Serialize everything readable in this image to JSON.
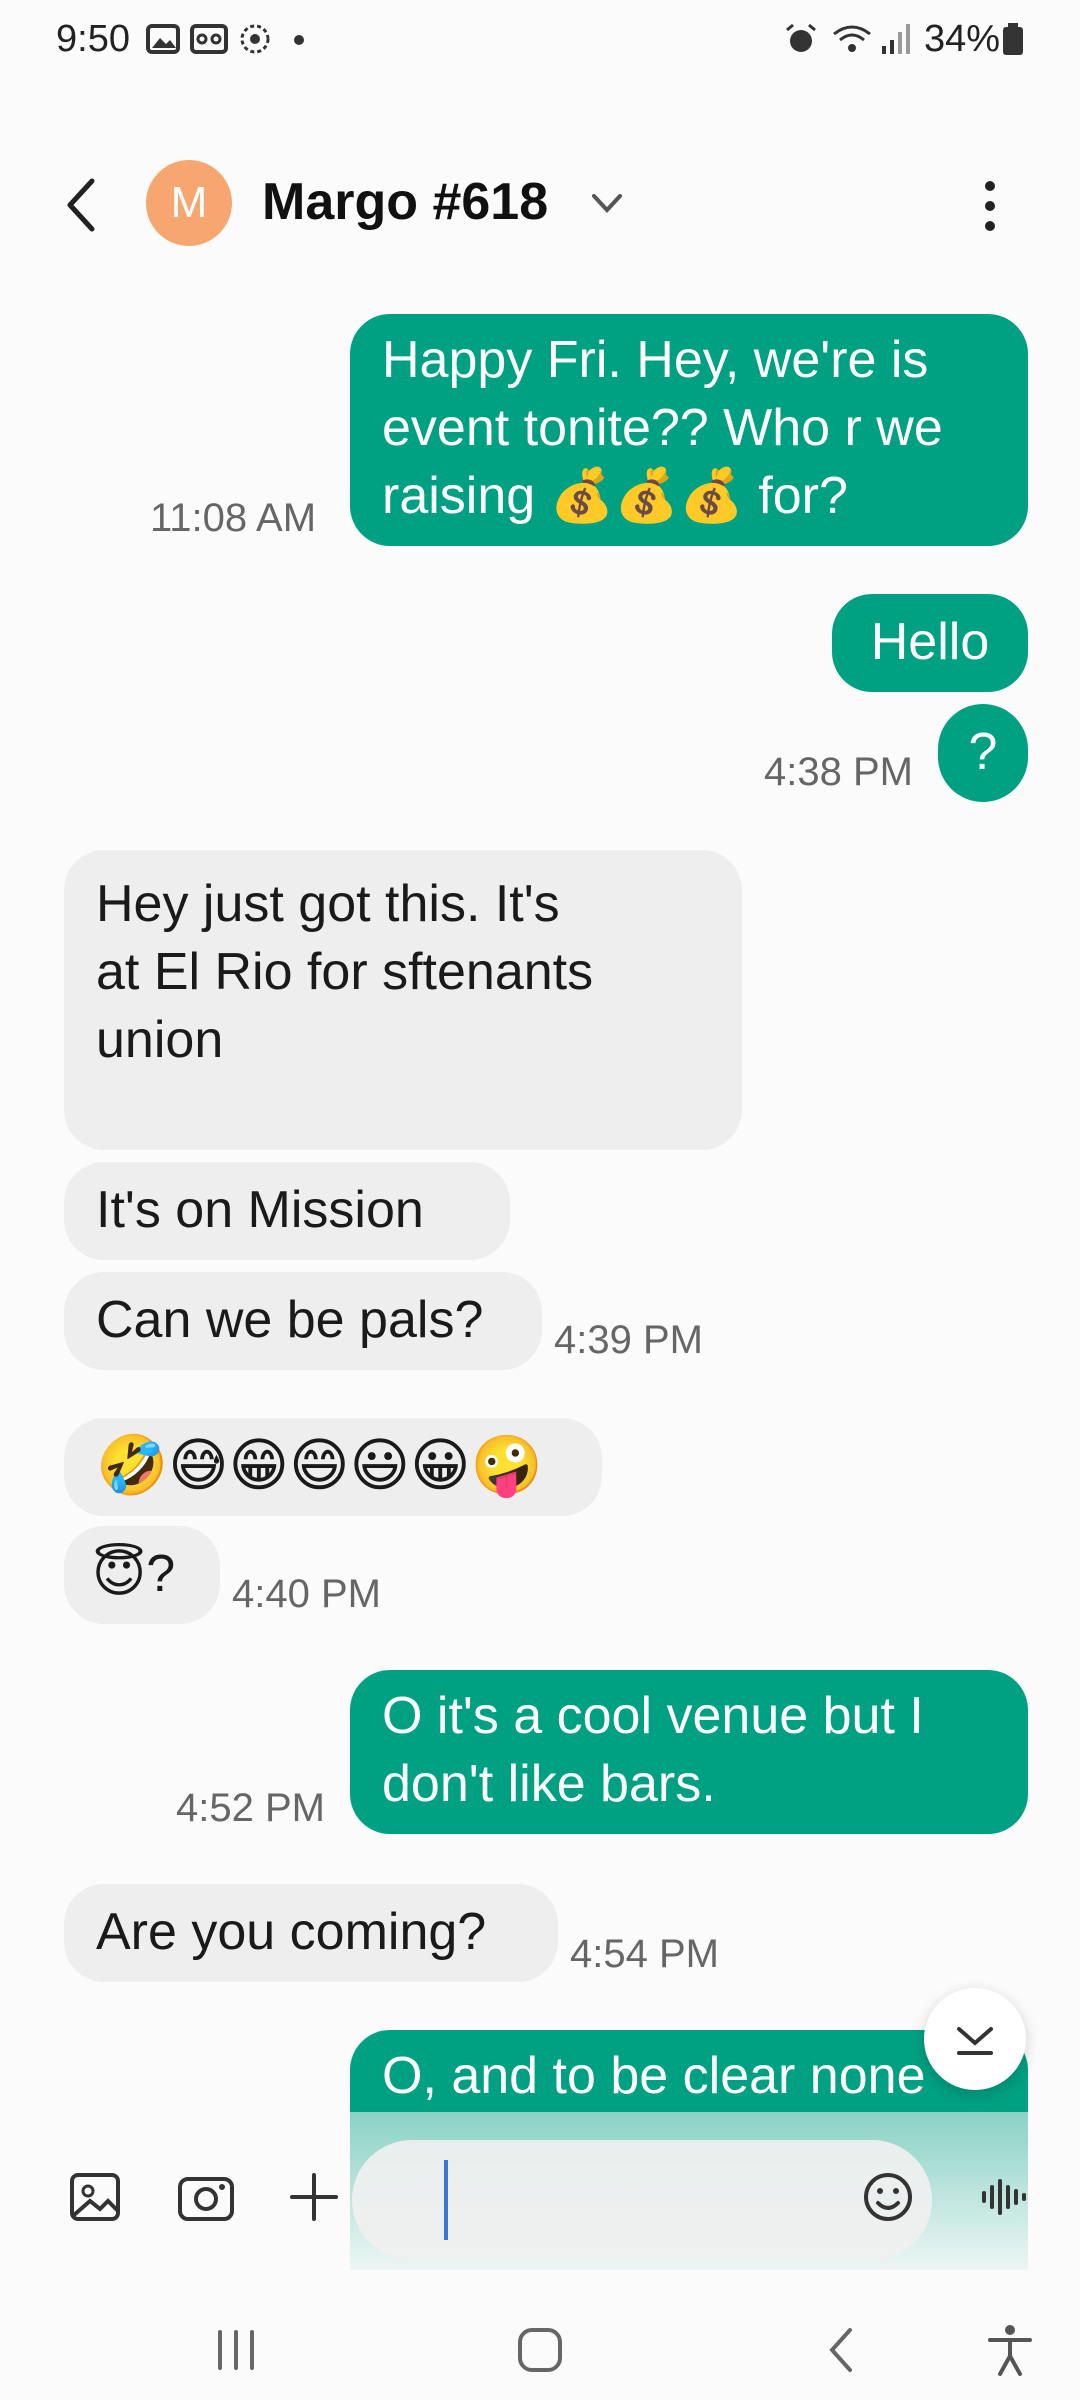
{
  "status_bar": {
    "time": "9:50",
    "battery": "34%"
  },
  "header": {
    "avatar_initial": "M",
    "contact_name": "Margo #618"
  },
  "messages": [
    {
      "side": "out",
      "text_lines": [
        "Happy Fri. Hey, we're is",
        "event tonite?? Who r we",
        "raising 💰💰💰 for?"
      ],
      "time": "11:08 AM"
    },
    {
      "side": "out",
      "text_lines": [
        "Hello"
      ],
      "time": ""
    },
    {
      "side": "out",
      "text_lines": [
        "?"
      ],
      "time": "4:38 PM"
    },
    {
      "side": "in",
      "text_lines": [
        "Hey just got this. It's",
        "at El Rio for sftenants",
        "union"
      ],
      "time": ""
    },
    {
      "side": "in",
      "text_lines": [
        "It's on Mission"
      ],
      "time": ""
    },
    {
      "side": "in",
      "text_lines": [
        "Can we be pals?"
      ],
      "time": "4:39 PM"
    },
    {
      "side": "in",
      "text_lines": [
        "🤣😅😁😄😃😀🤪"
      ],
      "time": ""
    },
    {
      "side": "in",
      "text_lines": [
        "😇?"
      ],
      "time": "4:40 PM"
    },
    {
      "side": "out",
      "text_lines": [
        "O it's a cool venue but I",
        "don't like bars."
      ],
      "time": "4:52 PM"
    },
    {
      "side": "in",
      "text_lines": [
        "Are you coming?"
      ],
      "time": "4:54 PM"
    },
    {
      "side": "out",
      "text_lines": [
        "O, and to be clear none"
      ],
      "time": ""
    }
  ],
  "compose": {
    "placeholder": ""
  },
  "icons": {
    "back": "chevron-left-icon",
    "dropdown": "chevron-down-icon",
    "more": "more-vert-icon",
    "gallery": "image-icon",
    "camera": "camera-icon",
    "add": "plus-icon",
    "emoji": "smiley-icon",
    "voice": "voice-wave-icon",
    "scroll": "scroll-down-icon"
  },
  "colors": {
    "outgoing_bubble": "#00a083",
    "incoming_bubble": "#eeeeee",
    "avatar": "#f7a66f"
  }
}
